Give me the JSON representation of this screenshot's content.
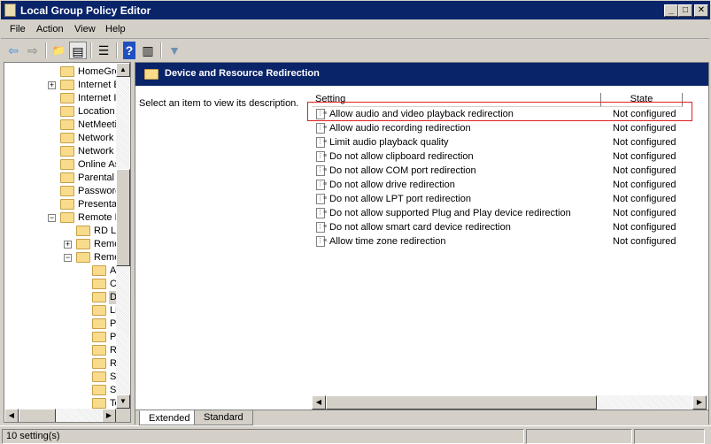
{
  "window": {
    "title": "Local Group Policy Editor",
    "minimize": "_",
    "maximize": "□",
    "close": "✕"
  },
  "menu": [
    "File",
    "Action",
    "View",
    "Help"
  ],
  "toolbar": [
    {
      "icon": "back-arrow-icon",
      "glyph": "⇦"
    },
    {
      "icon": "forward-arrow-icon",
      "glyph": "⇨"
    },
    {
      "icon": "up-folder-icon",
      "glyph": "📁"
    },
    {
      "icon": "show-hide-tree-icon",
      "glyph": "▤"
    },
    {
      "icon": "export-list-icon",
      "glyph": "☰"
    },
    {
      "icon": "help-icon",
      "glyph": "?"
    },
    {
      "icon": "show-action-pane-icon",
      "glyph": "▥"
    },
    {
      "icon": "filter-icon",
      "glyph": "▼"
    }
  ],
  "tree": [
    {
      "label": "HomeGrou",
      "level": 0
    },
    {
      "label": "Internet E",
      "level": 0,
      "expander": "+"
    },
    {
      "label": "Internet I",
      "level": 0
    },
    {
      "label": "Location a",
      "level": 0
    },
    {
      "label": "NetMeetin",
      "level": 0
    },
    {
      "label": "Network A",
      "level": 0
    },
    {
      "label": "Network F",
      "level": 0
    },
    {
      "label": "Online Ass",
      "level": 0
    },
    {
      "label": "Parental C",
      "level": 0
    },
    {
      "label": "Password",
      "level": 0
    },
    {
      "label": "Presentat",
      "level": 0
    },
    {
      "label": "Remote D",
      "level": 0,
      "expander": "−"
    },
    {
      "label": "RD Lic",
      "level": 1
    },
    {
      "label": "Remo",
      "level": 1,
      "expander": "+"
    },
    {
      "label": "Remo",
      "level": 1,
      "expander": "−"
    },
    {
      "label": "Ap",
      "level": 2
    },
    {
      "label": "Co",
      "level": 2
    },
    {
      "label": "De",
      "level": 2,
      "selected": true
    },
    {
      "label": "Li",
      "level": 2
    },
    {
      "label": "Pr",
      "level": 2
    },
    {
      "label": "Pr",
      "level": 2
    },
    {
      "label": "RI",
      "level": 2
    },
    {
      "label": "Re",
      "level": 2
    },
    {
      "label": "Se",
      "level": 2
    },
    {
      "label": "Se",
      "level": 2
    },
    {
      "label": "Te",
      "level": 2
    }
  ],
  "main": {
    "title": "Device and Resource Redirection",
    "description": "Select an item to view its description.",
    "columns": [
      "Setting",
      "State"
    ],
    "rows": [
      {
        "name": "Allow audio and video playback redirection",
        "state": "Not configured",
        "highlighted": true
      },
      {
        "name": "Allow audio recording redirection",
        "state": "Not configured"
      },
      {
        "name": "Limit audio playback quality",
        "state": "Not configured"
      },
      {
        "name": "Do not allow clipboard redirection",
        "state": "Not configured"
      },
      {
        "name": "Do not allow COM port redirection",
        "state": "Not configured"
      },
      {
        "name": "Do not allow drive redirection",
        "state": "Not configured"
      },
      {
        "name": "Do not allow LPT port redirection",
        "state": "Not configured"
      },
      {
        "name": "Do not allow supported Plug and Play device redirection",
        "state": "Not configured"
      },
      {
        "name": "Do not allow smart card device redirection",
        "state": "Not configured"
      },
      {
        "name": "Allow time zone redirection",
        "state": "Not configured"
      }
    ],
    "tabs": [
      "Extended",
      "Standard"
    ],
    "active_tab": "Extended"
  },
  "status": {
    "text": "10 setting(s)"
  },
  "colors": {
    "titlebar": "#0a246a",
    "highlight_box": "#e02020",
    "selection": "#d4d0c8"
  }
}
